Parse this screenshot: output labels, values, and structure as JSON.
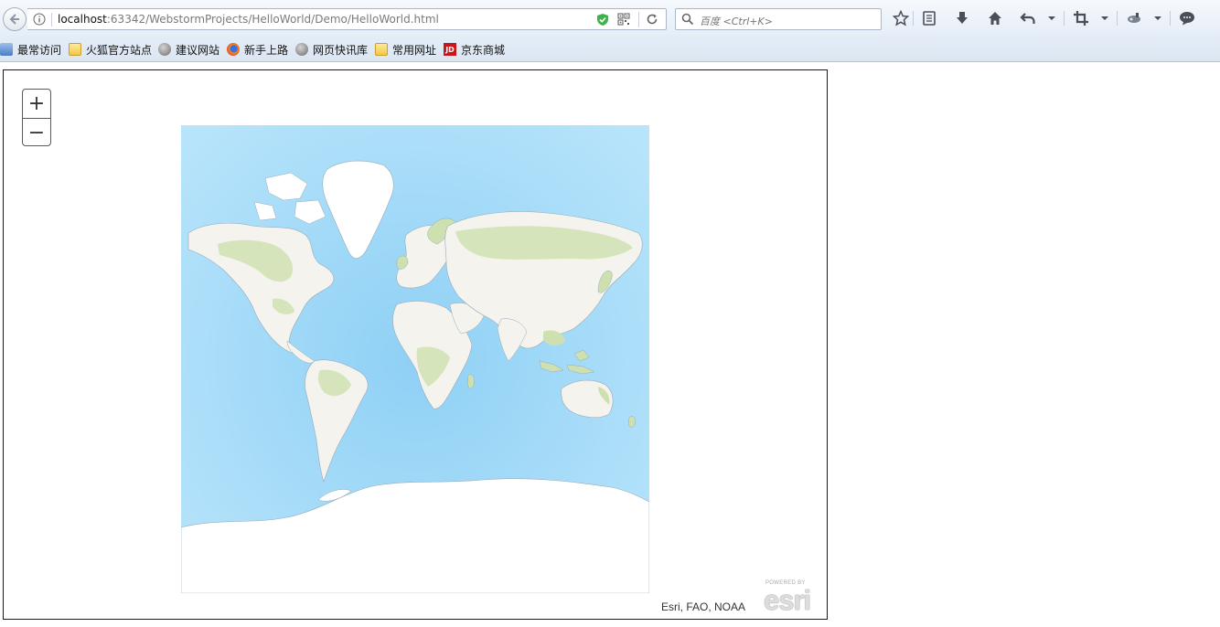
{
  "browser": {
    "url_host": "localhost",
    "url_path": ":63342/WebstormProjects/HelloWorld/Demo/HelloWorld.html",
    "search_placeholder": "百度 <Ctrl+K>"
  },
  "bookmarks": [
    {
      "label": "最常访问",
      "icon": "recent-icon"
    },
    {
      "label": "火狐官方站点",
      "icon": "folder-icon"
    },
    {
      "label": "建议网站",
      "icon": "globe-icon"
    },
    {
      "label": "新手上路",
      "icon": "firefox-icon"
    },
    {
      "label": "网页快讯库",
      "icon": "globe-icon"
    },
    {
      "label": "常用网址",
      "icon": "folder-icon"
    },
    {
      "label": "京东商城",
      "icon": "jd-icon",
      "badge": "JD"
    }
  ],
  "map": {
    "zoom_in_label": "+",
    "zoom_out_label": "−",
    "attribution": "Esri, FAO, NOAA",
    "logo_small_text": "POWERED BY",
    "logo_text": "esri"
  },
  "colors": {
    "ocean": "#9fd8f7",
    "deep_ocean": "#7dc6ef",
    "land": "#f4f3ee",
    "vegetation": "#cfe0b0",
    "ice": "#ffffff"
  }
}
